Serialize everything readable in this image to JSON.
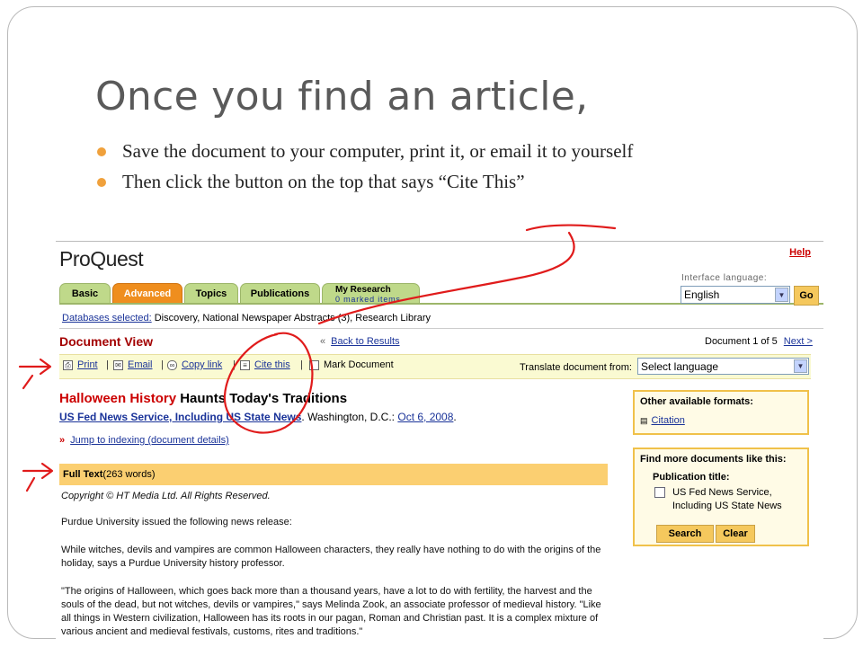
{
  "slide": {
    "title": "Once you find an article,",
    "bullets": [
      "Save the document to your computer, print it, or email it to yourself",
      "Then click the button on the top that says “Cite This”"
    ],
    "bullet_color": "#f0a13c",
    "annotation_color": "#e01b1b"
  },
  "proquest": {
    "logo": "ProQuest",
    "help": "Help",
    "tabs": [
      "Basic",
      "Advanced",
      "Topics",
      "Publications"
    ],
    "research_tab": {
      "label": "My Research",
      "sub": "0 marked items"
    },
    "interface_language_label": "Interface language:",
    "interface_language_value": "English",
    "go_label": "Go",
    "databases_label": "Databases selected:",
    "databases_value": "Discovery, National Newspaper Abstracts (3), Research Library",
    "document_view": "Document View",
    "back_to_results": "Back to Results",
    "doc_count": "Document 1 of 5",
    "next_link": "Next >",
    "toolbar": {
      "print": "Print",
      "email": "Email",
      "copy_link": "Copy link",
      "cite_this": "Cite this",
      "mark_document": "Mark Document",
      "translate_label": "Translate document from:",
      "translate_value": "Select language"
    },
    "article": {
      "title_red": "Halloween History",
      "title_black": "Haunts Today's Traditions",
      "source_link": "US Fed News Service, Including US State News",
      "place": ". Washington, D.C.: ",
      "date_link": "Oct 6, 2008",
      "jump_link": "Jump to indexing (document details)",
      "fulltext_label": "Full Text",
      "fulltext_words": " (263  words)",
      "copyright": "Copyright © HT Media Ltd. All Rights Reserved.",
      "p1": "Purdue University issued the following news release:",
      "p2": "While witches, devils and vampires are common Halloween characters, they really have nothing to do with the origins of the holiday, says a Purdue University history professor.",
      "p3": "\"The origins of Halloween, which goes back more than a thousand years, have a lot to do with fertility, the harvest and the souls of the dead, but not witches, devils or vampires,\" says Melinda Zook, an associate professor of medieval history. \"Like all things in Western civilization, Halloween has its roots in our pagan, Roman and Christian past. It is a complex mixture of various ancient and medieval festivals, customs, rites and traditions.\""
    },
    "formats_box": {
      "title": "Other available formats:",
      "citation": "Citation"
    },
    "more_box": {
      "title": "Find more documents like this:",
      "pub_label": "Publication title:",
      "pub_value_1": "US Fed News Service,",
      "pub_value_2": "Including US State News",
      "search_btn": "Search",
      "clear_btn": "Clear"
    }
  }
}
